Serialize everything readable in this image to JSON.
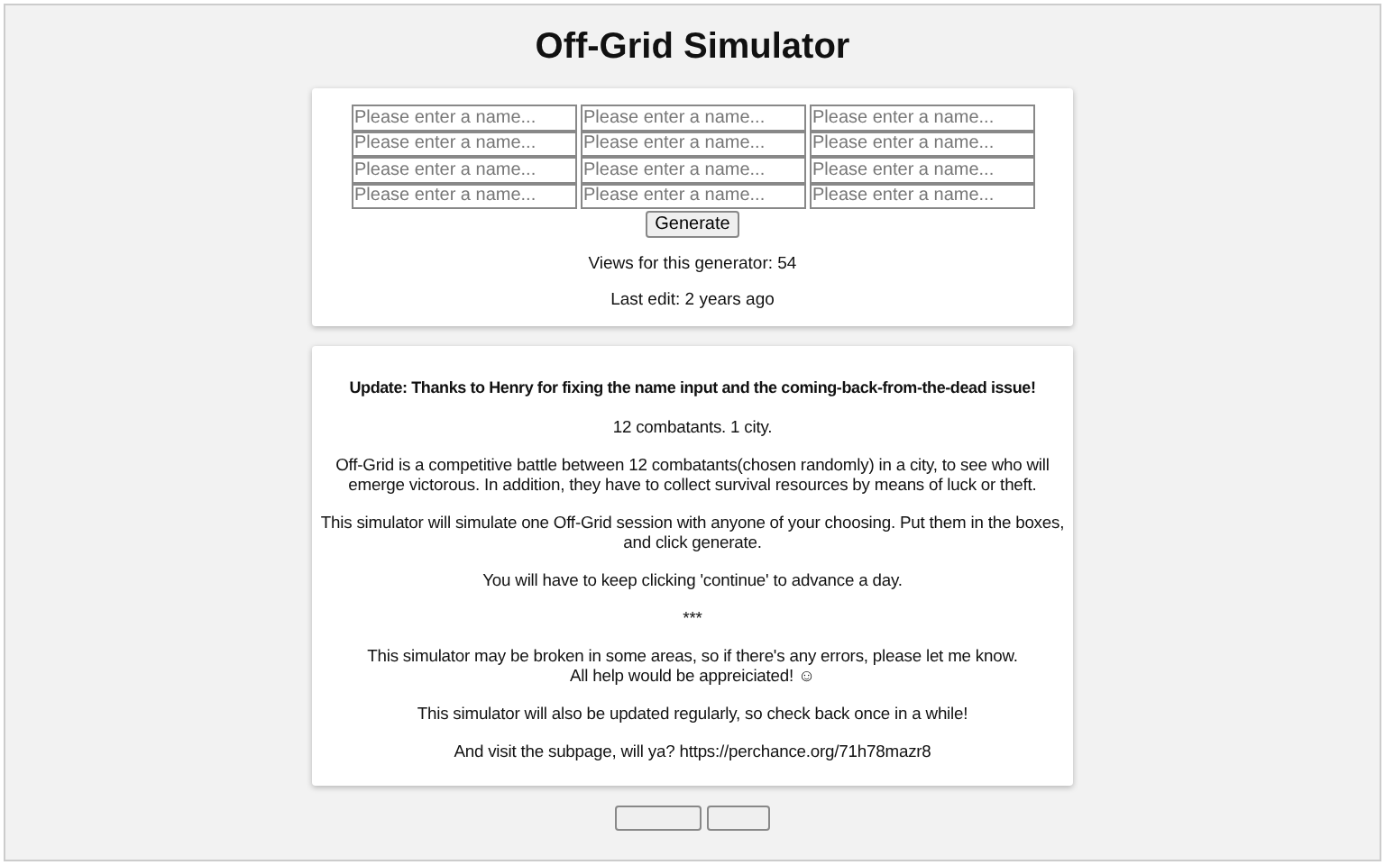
{
  "title": "Off-Grid Simulator",
  "name_inputs": [
    {
      "placeholder": "Please enter a name..."
    },
    {
      "placeholder": "Please enter a name..."
    },
    {
      "placeholder": "Please enter a name..."
    },
    {
      "placeholder": "Please enter a name..."
    },
    {
      "placeholder": "Please enter a name..."
    },
    {
      "placeholder": "Please enter a name..."
    },
    {
      "placeholder": "Please enter a name..."
    },
    {
      "placeholder": "Please enter a name..."
    },
    {
      "placeholder": "Please enter a name..."
    },
    {
      "placeholder": "Please enter a name..."
    },
    {
      "placeholder": "Please enter a name..."
    },
    {
      "placeholder": "Please enter a name..."
    }
  ],
  "generate_button": "Generate",
  "views": "Views for this generator: 54",
  "last_edit": "Last edit: 2 years ago",
  "description": [
    {
      "kind": "bold",
      "text": "Update: Thanks to Henry for fixing the name input and the coming-back-from-the-dead issue!"
    },
    {
      "kind": "plain",
      "text": "12 combatants. 1 city."
    },
    {
      "kind": "plain",
      "text": "Off-Grid is a competitive battle between 12 combatants(chosen randomly) in a city, to see who will emerge victorous. In addition, they have to collect survival resources by means of luck or theft."
    },
    {
      "kind": "plain",
      "text": "This simulator will simulate one Off-Grid session with anyone of your choosing. Put them in the boxes, and click generate."
    },
    {
      "kind": "plain",
      "text": "You will have to keep clicking 'continue' to advance a day."
    },
    {
      "kind": "plain",
      "text": "***"
    },
    {
      "kind": "lines",
      "lines": [
        "This simulator may be broken in some areas, so if there's any errors, please let me know.",
        "All help would be appreiciated! ☺"
      ]
    },
    {
      "kind": "plain",
      "text": "This simulator will also be updated regularly, so check back once in a while!"
    },
    {
      "kind": "plain",
      "text": "And visit the subpage, will ya? https://perchance.org/71h78mazr8"
    }
  ],
  "footer_buttons": [
    {
      "kind": "wide"
    },
    {
      "kind": "narrow"
    }
  ]
}
